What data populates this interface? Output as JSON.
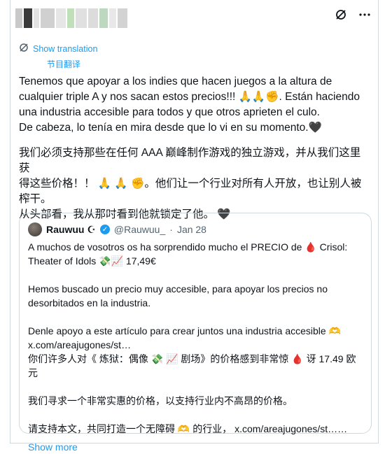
{
  "topbar": {
    "blur_colors": [
      "#c9c9c9",
      "#3a3a3a",
      "#e2e2e2",
      "#d0d0d0",
      "#e6e6e6",
      "#bfe0b8",
      "#e0e0e0",
      "#dcdcdc",
      "#bcd9c0",
      "#e8e8e8",
      "#d3d3d3"
    ],
    "icons": [
      "grok-icon",
      "more-icon"
    ]
  },
  "translation": {
    "show_label": "Show translation",
    "translated_by": "节目翻译"
  },
  "tweet": {
    "lines_es": [
      "Tenemos que apoyar a los indies que hacen juegos a la altura de",
      "cualquier triple A y nos sacan estos precios!!! 🙏🙏✊. Están haciendo",
      "una industria accesible para todos y que otros aprieten el culo.",
      "De cabeza, lo tenía en mira desde que lo vi en su momento.🖤"
    ],
    "lines_zh": [
      "我们必须支持那些在任何 AAA 巅峰制作游戏的独立游戏，并从我们这里获",
      "得这些价格！！ 🙏 🙏 ✊。他们让一个行业对所有人开放，也让别人被",
      "榨干。",
      "从头部看，我从那时看到他就锁定了他。 🖤"
    ]
  },
  "quote": {
    "name": "Rauwuu ☪",
    "handle": "@Rauwuu_",
    "separator": "·",
    "date": "Jan 28",
    "lines": [
      "A muchos de vosotros os ha sorprendido mucho el PRECIO de 🩸 Crisol:",
      "Theater of Idols 💸📈 17,49€",
      "",
      "Hemos buscado un precio muy accesible, para apoyar los precios no",
      "desorbitados en la industria.",
      "",
      "Denle apoyo a este artículo para crear juntos una industria accesible 🫶",
      "x.com/areajugones/st…",
      "你们许多人对《 炼狱：偶像 💸 📈 剧场》的价格感到非常惊 🩸 讶  17.49 欧元",
      "",
      "我们寻求一个非常实惠的价格，以支持行业内不高昂的价格。",
      "",
      "请支持本文，共同打造一个无障碍 🫶 的行业， x.com/areajugones/st……"
    ],
    "show_more": "Show more"
  }
}
